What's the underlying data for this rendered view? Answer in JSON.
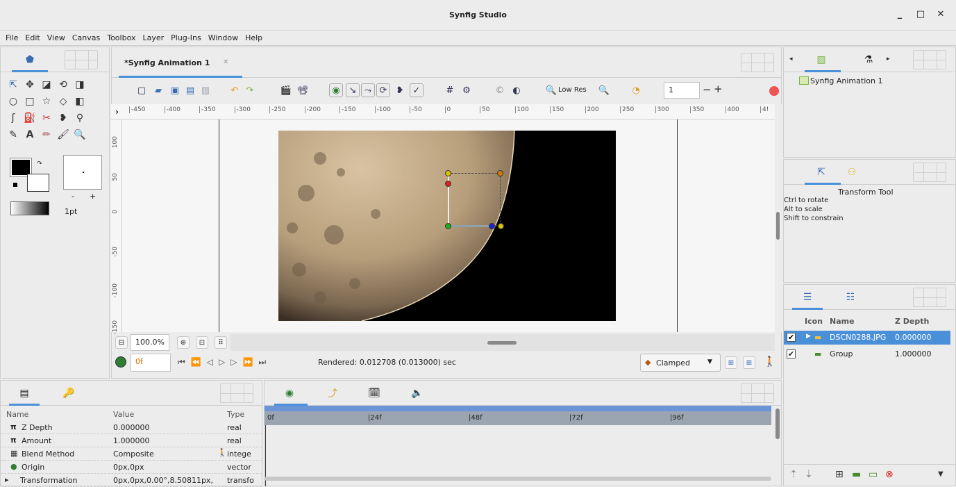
{
  "window": {
    "title": "Synfig Studio",
    "minimize": "_",
    "maximize": "□",
    "close": "✕"
  },
  "menu": [
    "File",
    "Edit",
    "View",
    "Canvas",
    "Toolbox",
    "Layer",
    "Plug-Ins",
    "Window",
    "Help"
  ],
  "document_tab": {
    "label": "*Synfig Animation 1",
    "close": "✕"
  },
  "toolbox": {
    "brush_size": "1pt",
    "bg_minus": "-",
    "bg_plus": "+"
  },
  "canvas_toolbar": {
    "low_res": "Low Res",
    "zoom_field": "1",
    "minus": "−",
    "plus": "+"
  },
  "ruler": {
    "labels": [
      "-450",
      "-400",
      "-350",
      "-300",
      "-250",
      "-200",
      "-150",
      "-100",
      "-50",
      "0",
      "50",
      "100",
      "150",
      "200",
      "250",
      "300",
      "350",
      "400",
      "4!"
    ]
  },
  "vruler": {
    "labels": [
      "100",
      "50",
      "0",
      "-50",
      "-100",
      "-150"
    ]
  },
  "canvas_bottom": {
    "zoom": "100.0%",
    "frame": "0f",
    "rendered": "Rendered: 0.012708 (0.013000) sec",
    "interp": "Clamped"
  },
  "canvas_browser": {
    "item": "Synfig Animation 1"
  },
  "tool_options": {
    "title": "Transform Tool",
    "lines": [
      "Ctrl to rotate",
      "Alt to scale",
      "Shift to constrain"
    ]
  },
  "layers": {
    "headers": {
      "icon": "Icon",
      "name": "Name",
      "zdepth": "Z Depth"
    },
    "rows": [
      {
        "name": "DSCN0288.JPG",
        "zdepth": "0.000000"
      },
      {
        "name": "Group",
        "zdepth": "1.000000"
      }
    ]
  },
  "params": {
    "headers": {
      "name": "Name",
      "value": "Value",
      "type": "Type"
    },
    "rows": [
      {
        "icon": "π",
        "name": "Z Depth",
        "value": "0.000000",
        "type": "real"
      },
      {
        "icon": "π",
        "name": "Amount",
        "value": "1.000000",
        "type": "real"
      },
      {
        "icon": "▦",
        "name": "Blend Method",
        "value": "Composite",
        "type": "intege"
      },
      {
        "icon": "●",
        "name": "Origin",
        "value": "0px,0px",
        "type": "vector"
      },
      {
        "icon": "▸",
        "name": "Transformation",
        "value": "0px,0px,0.00°,8.50811px,",
        "type": "transfo"
      }
    ]
  },
  "timetrack": {
    "labels": [
      "0f",
      "|24f",
      "|48f",
      "|72f",
      "|96f"
    ]
  },
  "colors": {
    "accent": "#4a90d9",
    "outline": "#000000",
    "fill": "#ffffff"
  }
}
